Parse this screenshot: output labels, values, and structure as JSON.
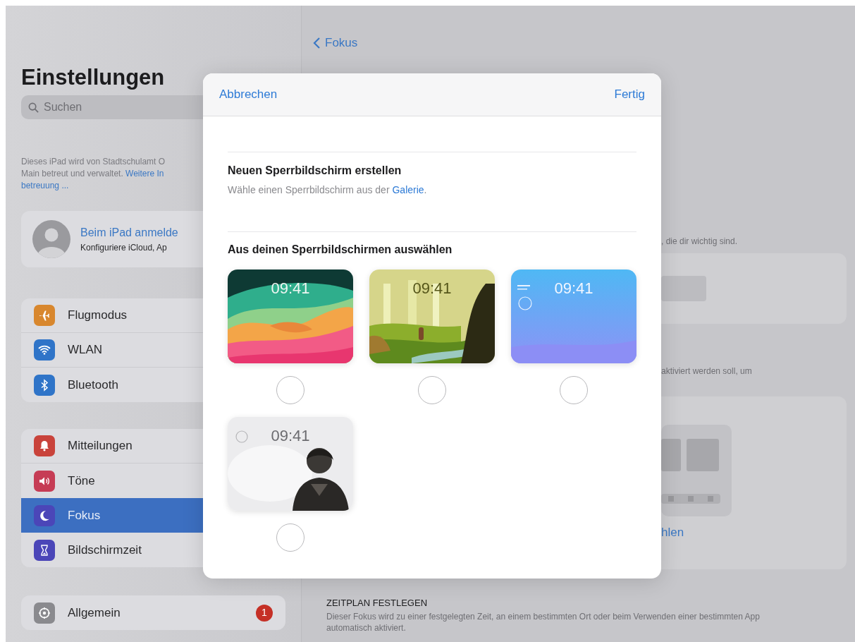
{
  "sidebar": {
    "title": "Einstellungen",
    "search": {
      "placeholder": "Suchen"
    },
    "notice": {
      "line1": "Dieses iPad wird von Stadtschulamt O",
      "line2": "Main betreut und verwaltet.",
      "link1": "Weitere In",
      "link2": "betreuung ..."
    },
    "account": {
      "name": "Beim iPad anmelde",
      "subtitle": "Konfiguriere iCloud, Ap"
    },
    "groups": [
      {
        "items": [
          {
            "label": "Flugmodus",
            "color": "#d8872e",
            "selected": false
          },
          {
            "label": "WLAN",
            "color": "#2f74c8",
            "selected": false
          },
          {
            "label": "Bluetooth",
            "color": "#2f74c8",
            "selected": false
          }
        ]
      },
      {
        "items": [
          {
            "label": "Mitteilungen",
            "color": "#c9433b",
            "selected": false
          },
          {
            "label": "Töne",
            "color": "#c63c55",
            "selected": false
          },
          {
            "label": "Fokus",
            "color": "#4b46b8",
            "selected": true
          },
          {
            "label": "Bildschirmzeit",
            "color": "#4b46b8",
            "selected": false
          }
        ]
      },
      {
        "items": [
          {
            "label": "Allgemein",
            "color": "#8a8a8e",
            "selected": false,
            "badge": "1"
          }
        ]
      }
    ]
  },
  "detail": {
    "back": "Fokus",
    "text1": ", die dir wichtig sind.",
    "text2": "aktiviert werden soll, um",
    "link": "hlen",
    "section_header": "ZEITPLAN FESTLEGEN",
    "section_text": "Dieser Fokus wird zu einer festgelegten Zeit, an einem bestimmten Ort oder beim Verwenden einer bestimmten App automatisch aktiviert."
  },
  "sheet": {
    "cancel": "Abbrechen",
    "done": "Fertig",
    "create_title": "Neuen Sperrbildschirm erstellen",
    "create_text": "Wähle einen Sperrbildschirm aus der",
    "create_link": "Galerie",
    "create_end": ".",
    "section": "Aus deinen Sperrbildschirmen auswählen",
    "lockscreens": [
      {
        "time": "09:41",
        "selected": false
      },
      {
        "time": "09:41",
        "selected": false
      },
      {
        "time": "09:41",
        "selected": false
      },
      {
        "time": "09:41",
        "selected": false
      }
    ]
  }
}
